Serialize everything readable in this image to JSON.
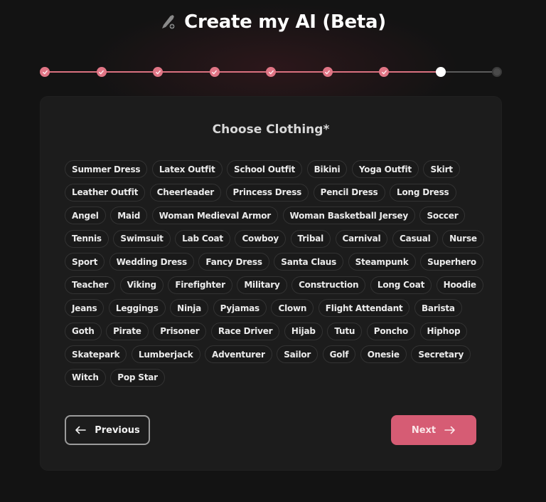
{
  "header": {
    "title": "Create my AI (Beta)",
    "icon": "pencil-plus-icon"
  },
  "stepper": {
    "total_steps": 9,
    "completed_steps": 7,
    "current_step": 8,
    "colors": {
      "done": "#e07585",
      "current": "#ffffff",
      "todo": "#4a4a4a"
    }
  },
  "card": {
    "title": "Choose Clothing*",
    "options": [
      "Summer Dress",
      "Latex Outfit",
      "School Outfit",
      "Bikini",
      "Yoga Outfit",
      "Skirt",
      "Leather Outfit",
      "Cheerleader",
      "Princess Dress",
      "Pencil Dress",
      "Long Dress",
      "Angel",
      "Maid",
      "Woman Medieval Armor",
      "Woman Basketball Jersey",
      "Soccer",
      "Tennis",
      "Swimsuit",
      "Lab Coat",
      "Cowboy",
      "Tribal",
      "Carnival",
      "Casual",
      "Nurse",
      "Sport",
      "Wedding Dress",
      "Fancy Dress",
      "Santa Claus",
      "Steampunk",
      "Superhero",
      "Teacher",
      "Viking",
      "Firefighter",
      "Military",
      "Construction",
      "Long Coat",
      "Hoodie",
      "Jeans",
      "Leggings",
      "Ninja",
      "Pyjamas",
      "Clown",
      "Flight Attendant",
      "Barista",
      "Goth",
      "Pirate",
      "Prisoner",
      "Race Driver",
      "Hijab",
      "Tutu",
      "Poncho",
      "Hiphop",
      "Skatepark",
      "Lumberjack",
      "Adventurer",
      "Sailor",
      "Golf",
      "Onesie",
      "Secretary",
      "Witch",
      "Pop Star"
    ]
  },
  "buttons": {
    "previous_label": "Previous",
    "next_label": "Next",
    "previous_icon": "arrow-left-icon",
    "next_icon": "arrow-right-icon",
    "accent": "#d65c74"
  }
}
